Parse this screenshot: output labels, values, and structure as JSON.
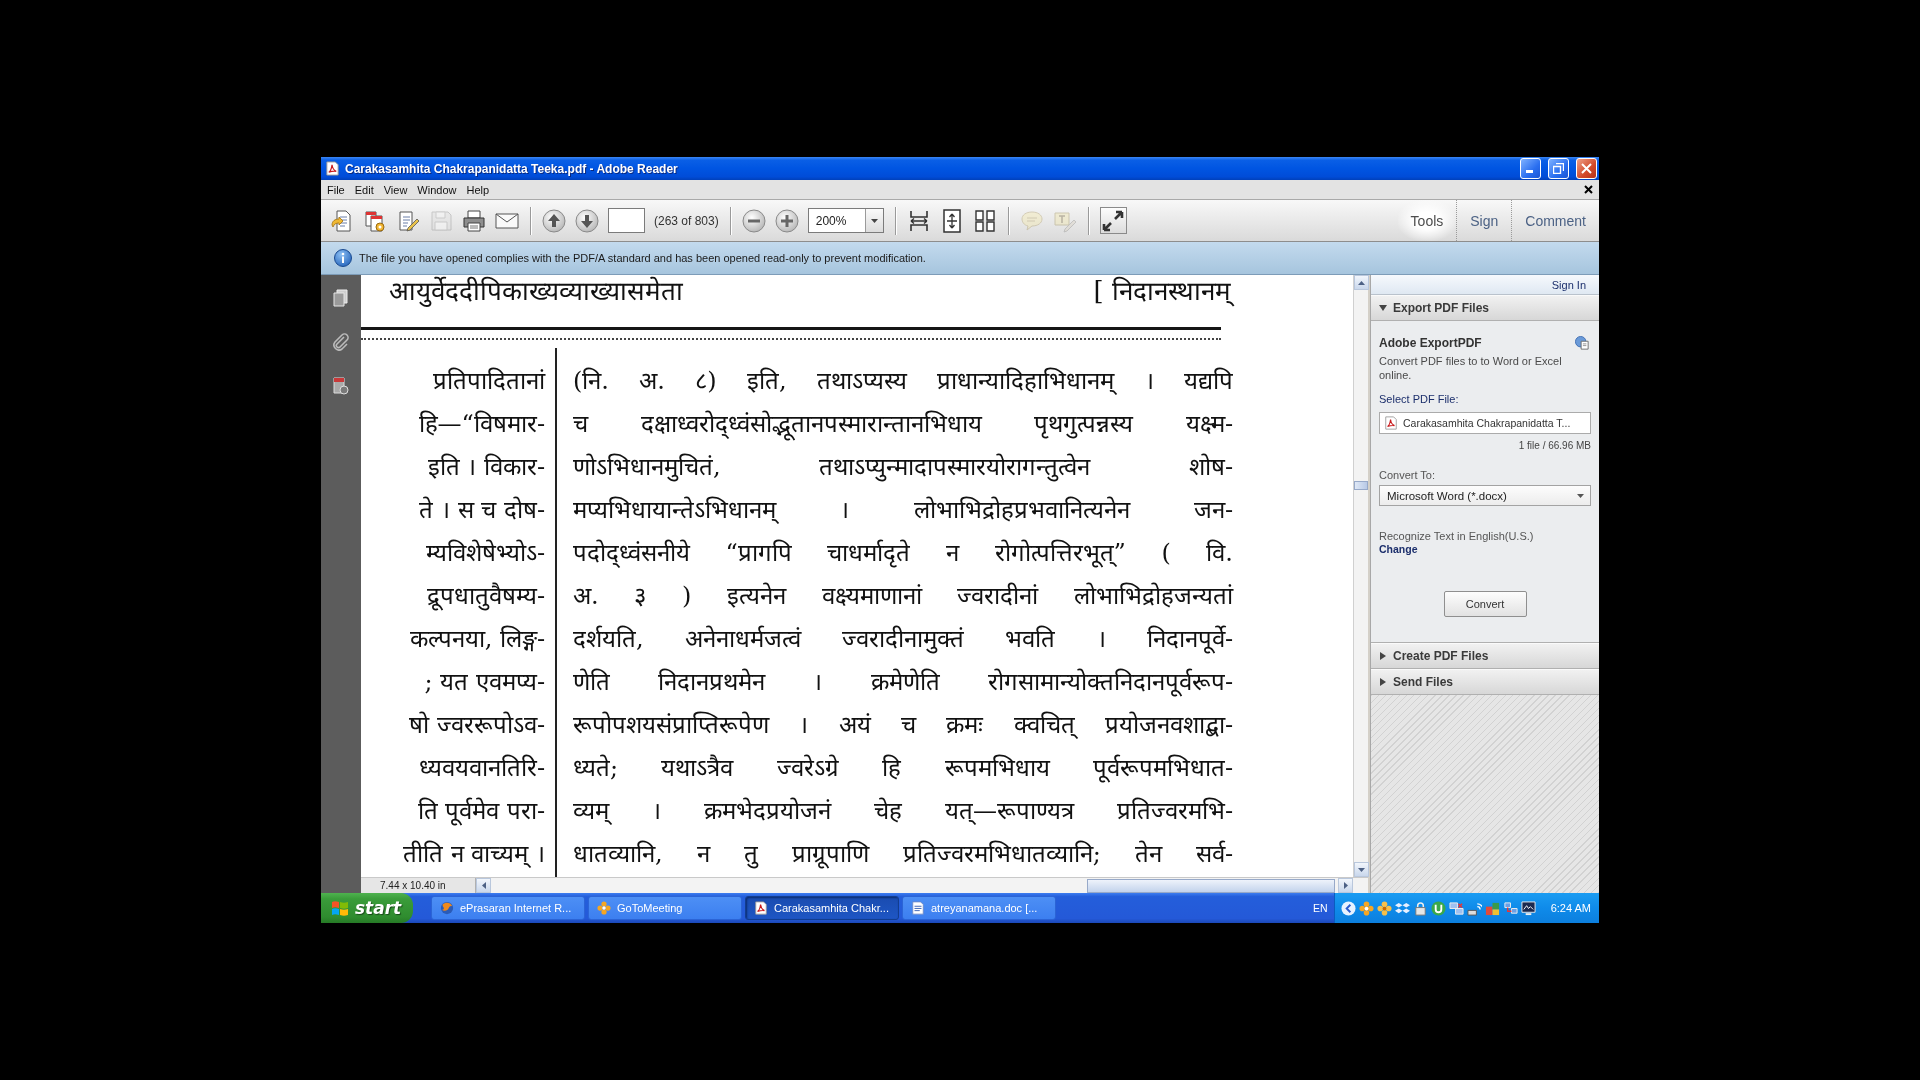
{
  "window": {
    "title": "Carakasamhita Chakrapanidatta Teeka.pdf - Adobe Reader"
  },
  "menu": [
    {
      "label": "File"
    },
    {
      "label": "Edit"
    },
    {
      "label": "View"
    },
    {
      "label": "Window"
    },
    {
      "label": "Help"
    }
  ],
  "toolbar": {
    "file_buttons": [
      {
        "kind": "open",
        "disabled": false
      },
      {
        "kind": "create",
        "disabled": false
      },
      {
        "kind": "edit",
        "disabled": false
      },
      {
        "kind": "save",
        "disabled": true
      },
      {
        "kind": "print",
        "disabled": false
      },
      {
        "kind": "email",
        "disabled": false
      }
    ],
    "page_buttons": [
      {
        "kind": "previous",
        "disabled": false
      },
      {
        "kind": "next",
        "disabled": false
      }
    ],
    "page_count": "(263 of 803)",
    "zoom_buttons": [
      {
        "kind": "zoom_out",
        "disabled": false
      },
      {
        "kind": "zoom_in",
        "disabled": false
      }
    ],
    "zoom": "200%",
    "view_buttons": [
      {
        "kind": "fit_width",
        "disabled": false
      },
      {
        "kind": "fit_page",
        "disabled": false
      },
      {
        "kind": "spread",
        "disabled": false
      }
    ],
    "comment_buttons": [
      {
        "kind": "comment",
        "disabled": true
      },
      {
        "kind": "highlight",
        "disabled": true
      }
    ],
    "mode_buttons": [
      {
        "kind": "full_screen",
        "disabled": false
      }
    ],
    "panel_tabs": [
      {
        "label": "Tools",
        "selected": true
      },
      {
        "label": "Sign",
        "selected": false
      },
      {
        "label": "Comment",
        "selected": false
      }
    ]
  },
  "info_bar": {
    "message": "The file you have opened complies with the PDF/A standard and has been opened read-only to prevent modification."
  },
  "document": {
    "running_head_left": "आयुर्वेददीपिकाख्यव्याख्यासमेता",
    "running_head_right": "[ निदानस्थानम्",
    "left_column": [
      "प्रतिपादितानां",
      "हि—“विषमार-",
      "इति । विकार-",
      "ते । स च दोष-",
      "म्यविशेषेभ्योऽ-",
      "द्रूपधातुवैषम्य-",
      "कल्पनया, लिङ्ग-",
      "; यत एवमप्य-",
      "षो ज्वररूपोऽव-",
      "ध्यवयवानतिरि-",
      "ति पूर्वमेव परा-",
      "तीति न वाच्यम् ।"
    ],
    "right_column": [
      "(नि. अ. ८) इति, तथाऽप्यस्य प्राधान्यादिहाभिधानम् । यद्यपि",
      "च दक्षाध्वरोद्ध्वंसोद्भूतानपस्मारान्तानभिधाय पृथगुत्पन्नस्य यक्ष्म-",
      "णोऽभिधानमुचितं, तथाऽप्युन्मादापस्मारयोरागन्तुत्वेन शोष-",
      "मप्यभिधायान्तेऽभिधानम् । लोभाभिद्रोहप्रभवानित्यनेन जन-",
      "पदोद्ध्वंसनीये “प्रागपि चाधर्मादृते न रोगोत्पत्तिरभूत्” ( वि.",
      "अ. ३ ) इत्यनेन वक्ष्यमाणानां ज्वरादीनां लोभाभिद्रोहजन्यतां",
      "दर्शयति, अनेनाधर्मजत्वं ज्वरादीनामुक्तं भवति । निदानपूर्वे-",
      "णेति निदानप्रथमेन । क्रमेणेति रोगसामान्योक्तनिदानपूर्वरूप-",
      "रूपोपशयसंप्राप्तिरूपेण । अयं च क्रमः क्वचित् प्रयोजनवशाद्बा-",
      "ध्यते; यथाऽत्रैव ज्वरेऽग्रे हि रूपमभिधाय पूर्वरूपमभिधात-",
      "व्यम् । क्रमभेदप्रयोजनं चेह यत्—रूपाण्यत्र प्रतिज्वरमभि-",
      "धातव्यानि, न तु प्राग्रूपाणि प्रतिज्वरमभिधातव्यानि; तेन सर्व-"
    ],
    "page_size": "7.44 x 10.40 in"
  },
  "right_pane": {
    "sign_in": "Sign In",
    "sections": [
      {
        "title": "Export PDF Files",
        "expanded": true,
        "panel": {
          "heading": "Adobe ExportPDF",
          "description": "Convert PDF files to to Word or Excel online.",
          "select_label": "Select PDF File:",
          "file_name": "Carakasamhita Chakrapanidatta T...",
          "file_info": "1 file / 66.96 MB",
          "convert_to_label": "Convert To:",
          "format": "Microsoft Word (*.docx)",
          "recognize": "Recognize Text in English(U.S.)",
          "change_link": "Change",
          "convert_button": "Convert"
        }
      },
      {
        "title": "Create PDF Files",
        "expanded": false
      },
      {
        "title": "Send Files",
        "expanded": false
      }
    ]
  },
  "taskbar": {
    "start": "start",
    "tasks": [
      {
        "kind": "browser",
        "label": "ePrasaran Internet R...",
        "selected": false
      },
      {
        "kind": "meeting",
        "label": "GoToMeeting",
        "selected": false
      },
      {
        "kind": "pdf",
        "label": "Carakasamhita Chakr...",
        "selected": true
      },
      {
        "kind": "word",
        "label": "atreyanamana.doc [...",
        "selected": false
      }
    ],
    "language": "EN",
    "clock": "6:24 AM"
  }
}
